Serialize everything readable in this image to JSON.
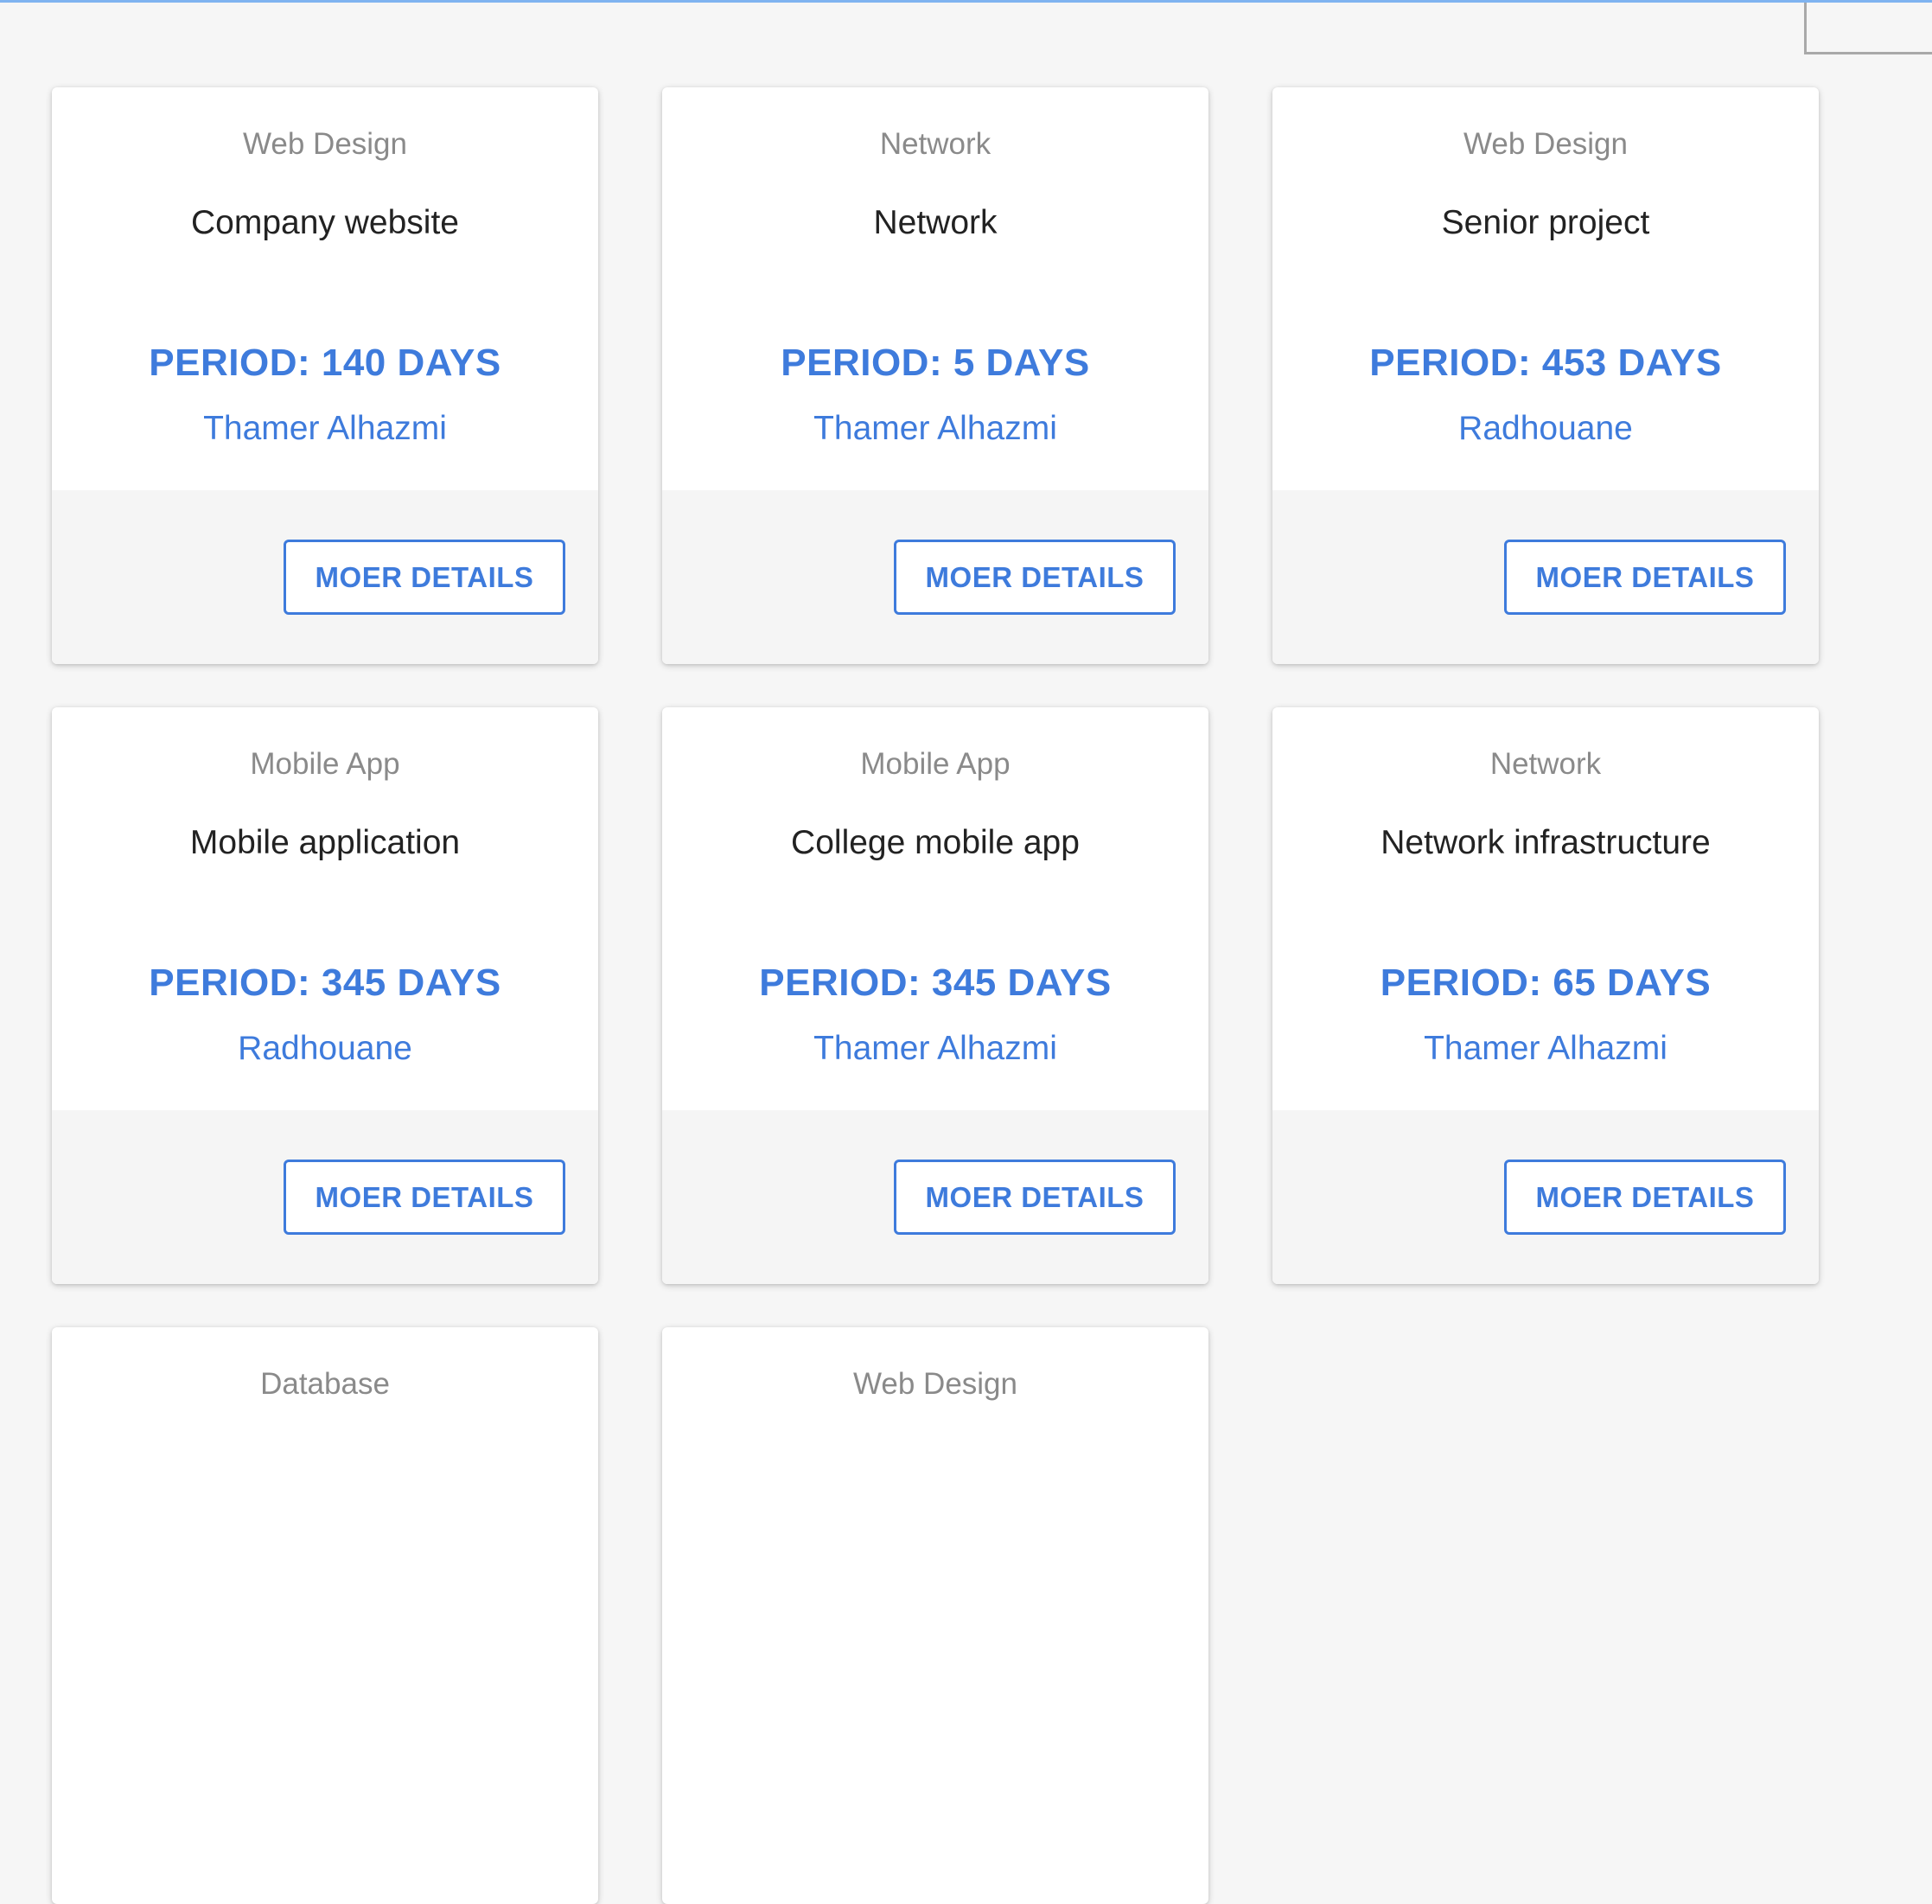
{
  "cards": [
    {
      "category": "Web Design",
      "title": "Company website",
      "period": "PERIOD: 140 DAYS",
      "author": "Thamer Alhazmi",
      "button": "MOER DETAILS"
    },
    {
      "category": "Network",
      "title": "Network",
      "period": "PERIOD: 5 DAYS",
      "author": "Thamer Alhazmi",
      "button": "MOER DETAILS"
    },
    {
      "category": "Web Design",
      "title": "Senior project",
      "period": "PERIOD: 453 DAYS",
      "author": "Radhouane",
      "button": "MOER DETAILS"
    },
    {
      "category": "Mobile App",
      "title": "Mobile application",
      "period": "PERIOD: 345 DAYS",
      "author": "Radhouane",
      "button": "MOER DETAILS"
    },
    {
      "category": "Mobile App",
      "title": "College mobile app",
      "period": "PERIOD: 345 DAYS",
      "author": "Thamer Alhazmi",
      "button": "MOER DETAILS"
    },
    {
      "category": "Network",
      "title": "Network infrastructure",
      "period": "PERIOD: 65 DAYS",
      "author": "Thamer Alhazmi",
      "button": "MOER DETAILS"
    },
    {
      "category": "Database"
    },
    {
      "category": "Web Design"
    }
  ],
  "colors": {
    "accent": "#3e7bdc",
    "background": "#f6f6f6",
    "card": "#ffffff",
    "footer": "#f5f5f5"
  }
}
